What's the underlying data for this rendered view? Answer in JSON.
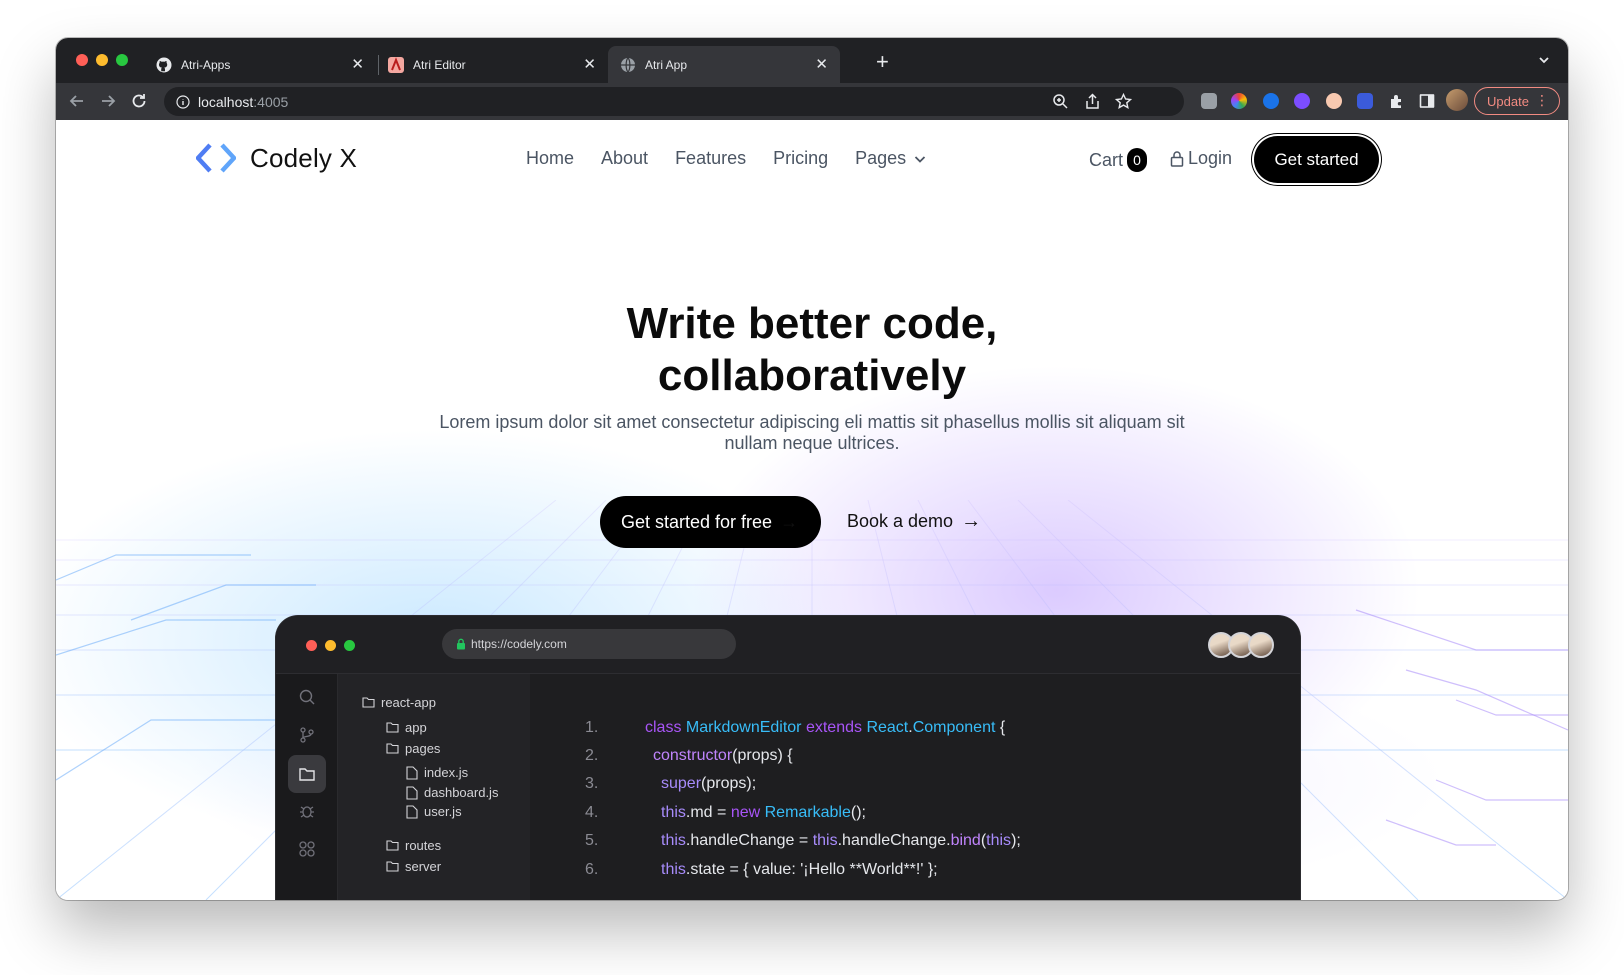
{
  "browser": {
    "tabs": [
      {
        "title": "Atri-Apps",
        "favicon": "github-icon",
        "active": false
      },
      {
        "title": "Atri Editor",
        "favicon": "atri-icon",
        "active": false
      },
      {
        "title": "Atri App",
        "favicon": "globe-icon",
        "active": true
      }
    ],
    "url_host": "localhost",
    "url_port": ":4005",
    "update_label": "Update"
  },
  "site": {
    "brand": "Codely X",
    "nav": [
      "Home",
      "About",
      "Features",
      "Pricing",
      "Pages"
    ],
    "cart_label": "Cart",
    "cart_count": "0",
    "login_label": "Login",
    "cta_label": "Get started"
  },
  "hero": {
    "title_line1": "Write better code,",
    "title_line2": "collaboratively",
    "subtitle": "Lorem ipsum dolor sit amet consectetur adipiscing eli mattis sit phasellus mollis sit aliquam sit nullam neque ultrices.",
    "primary_cta": "Get started for free",
    "secondary_cta": "Book a demo"
  },
  "editor": {
    "url": "https://codely.com",
    "tree": {
      "root": "react-app",
      "folders": [
        "app",
        "pages",
        "routes",
        "server"
      ],
      "files": [
        "index.js",
        "dashboard.js",
        "user.js"
      ]
    },
    "line_numbers": [
      "1.",
      "2.",
      "3.",
      "4.",
      "5.",
      "6."
    ],
    "code": {
      "l1": {
        "a": "class ",
        "b": "MarkdownEditor ",
        "c": "extends ",
        "d": "React",
        "e": ".",
        "f": "Component",
        "g": " {"
      },
      "l2": {
        "a": "constructor",
        "b": "(props) {"
      },
      "l3": {
        "a": "super",
        "b": "(props);"
      },
      "l4": {
        "a": "this",
        "b": ".md = ",
        "c": "new ",
        "d": "Remarkable",
        "e": "();"
      },
      "l5": {
        "a": "this",
        "b": ".handleChange = ",
        "c": "this",
        "d": ".handleChange.",
        "e": "bind",
        "f": "(",
        "g": "this",
        "h": ");"
      },
      "l6": {
        "a": "this",
        "b": ".state = { value: '¡Hello **World**!' };"
      }
    }
  },
  "colors": {
    "accent": "#000000",
    "brand_icon": "#4f7df3",
    "code_type": "#38bdf8",
    "code_keyword": "#a855f7"
  }
}
